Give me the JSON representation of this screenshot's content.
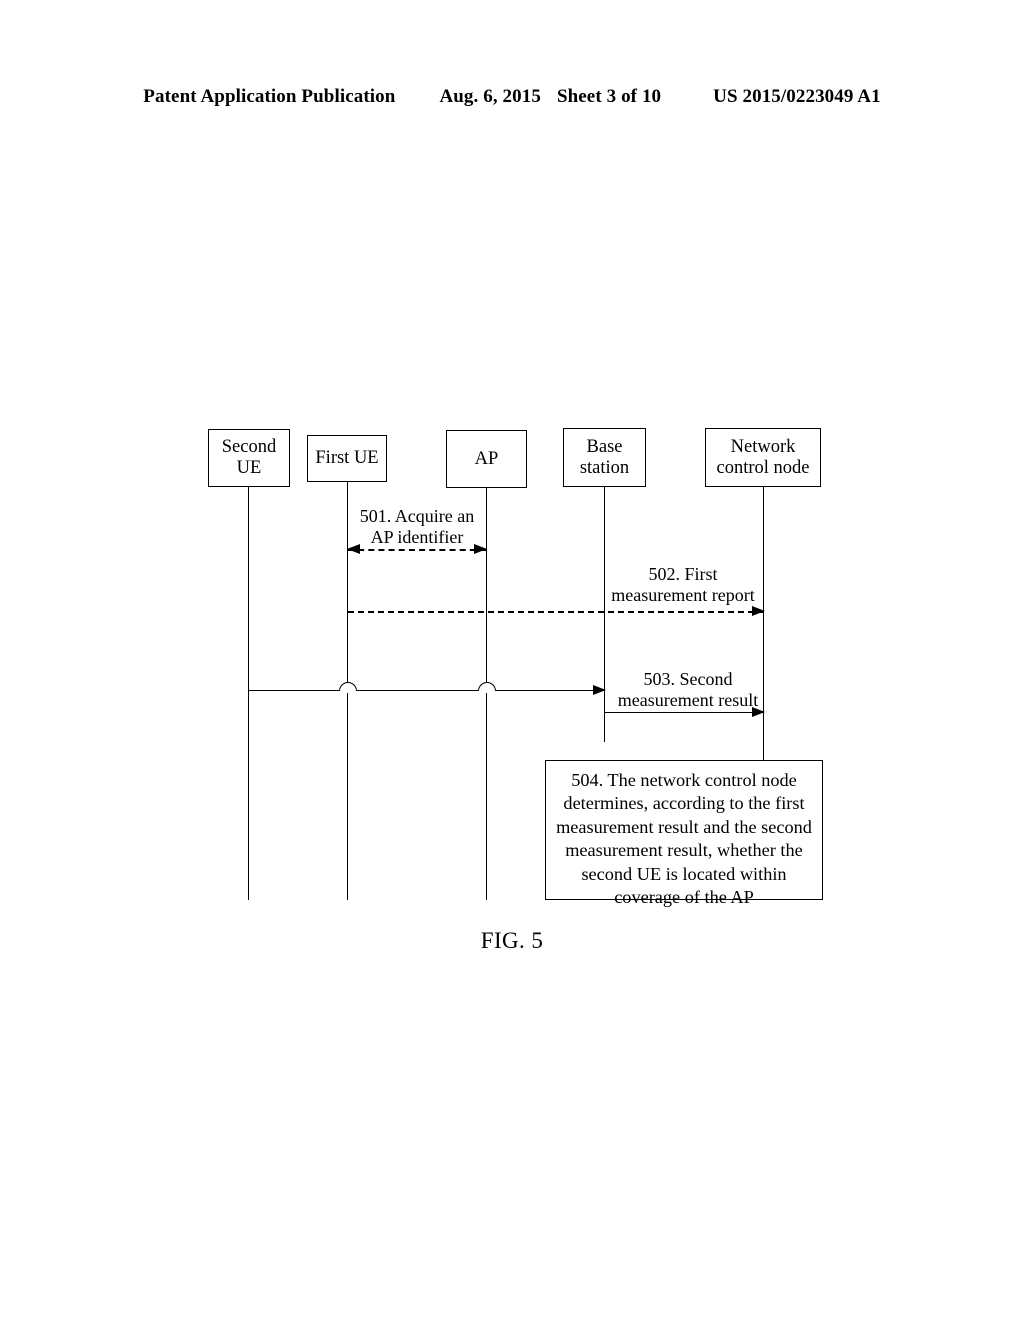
{
  "header": {
    "publication": "Patent Application Publication",
    "date": "Aug. 6, 2015",
    "sheet": "Sheet 3 of 10",
    "document_number": "US 2015/0223049 A1"
  },
  "figure": {
    "caption": "FIG. 5",
    "entities": [
      {
        "id": "second-ue",
        "label": "Second\nUE"
      },
      {
        "id": "first-ue",
        "label": "First UE"
      },
      {
        "id": "ap",
        "label": "AP"
      },
      {
        "id": "base-station",
        "label": "Base\nstation"
      },
      {
        "id": "network-control-node",
        "label": "Network\ncontrol node"
      }
    ],
    "messages": [
      {
        "id": "501",
        "label": "501. Acquire an\nAP identifier",
        "style": "dashed",
        "direction": "bidirectional",
        "from": "first-ue",
        "to": "ap"
      },
      {
        "id": "502",
        "label": "502. First\nmeasurement report",
        "style": "dashed",
        "direction": "right",
        "from": "first-ue",
        "to": "network-control-node"
      },
      {
        "id": "503-source",
        "label": "",
        "style": "solid",
        "direction": "right",
        "from": "second-ue",
        "to": "base-station"
      },
      {
        "id": "503",
        "label": "503. Second\nmeasurement result",
        "style": "solid",
        "direction": "right",
        "from": "base-station",
        "to": "network-control-node"
      }
    ],
    "process": {
      "id": "504",
      "label": "504. The network control node determines, according to the first measurement result and the second measurement result, whether the second UE is located within coverage of the AP"
    }
  },
  "colors": {
    "ink": "#000000",
    "page": "#ffffff"
  }
}
